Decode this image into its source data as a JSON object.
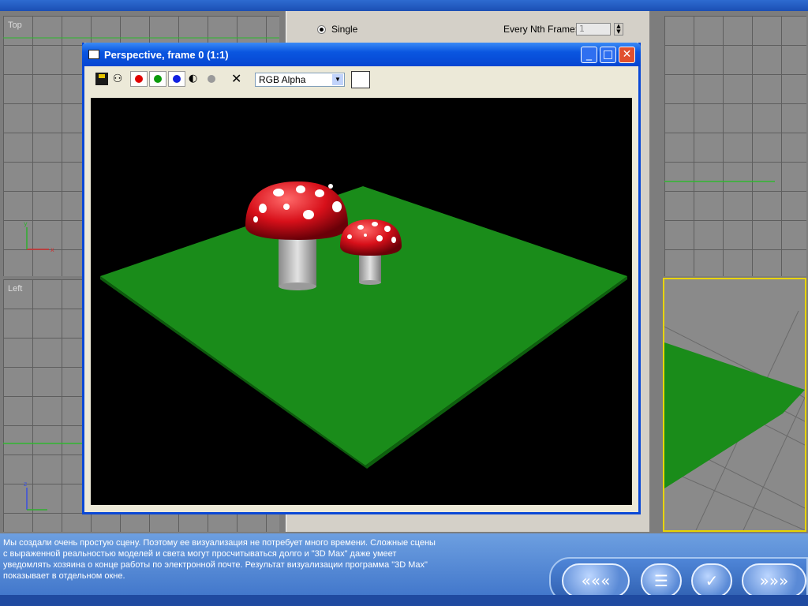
{
  "viewports": {
    "top_label": "Top",
    "left_label": "Left"
  },
  "command_panel": {
    "radio_single": "Single",
    "nth_frame_label": "Every Nth Frame:",
    "nth_frame_value": "1"
  },
  "render_window": {
    "title": "Perspective, frame 0 (1:1)",
    "channel_select": "RGB Alpha",
    "channels": [
      {
        "name": "red",
        "color": "#e00000"
      },
      {
        "name": "green",
        "color": "#0a9a0a"
      },
      {
        "name": "blue",
        "color": "#1020e0"
      }
    ]
  },
  "caption": {
    "text": "Мы создали очень простую сцену. Поэтому ее визуализация не потребует много времени. Сложные сцены\nс выраженной реальностью моделей и света могут просчитываться долго и \"3D Max\" даже умеет\nуведомлять хозяина о конце работы по электронной почте. Результат визуализации программа \"3D Max\"\nпоказывает в отдельном окне."
  },
  "colors": {
    "ground": "#1a8c1a",
    "mushroom_cap": "#d8101a",
    "mushroom_stem": "#b4b4b4",
    "title_bar": "#0a56e0",
    "active_viewport_border": "#e8d400"
  }
}
